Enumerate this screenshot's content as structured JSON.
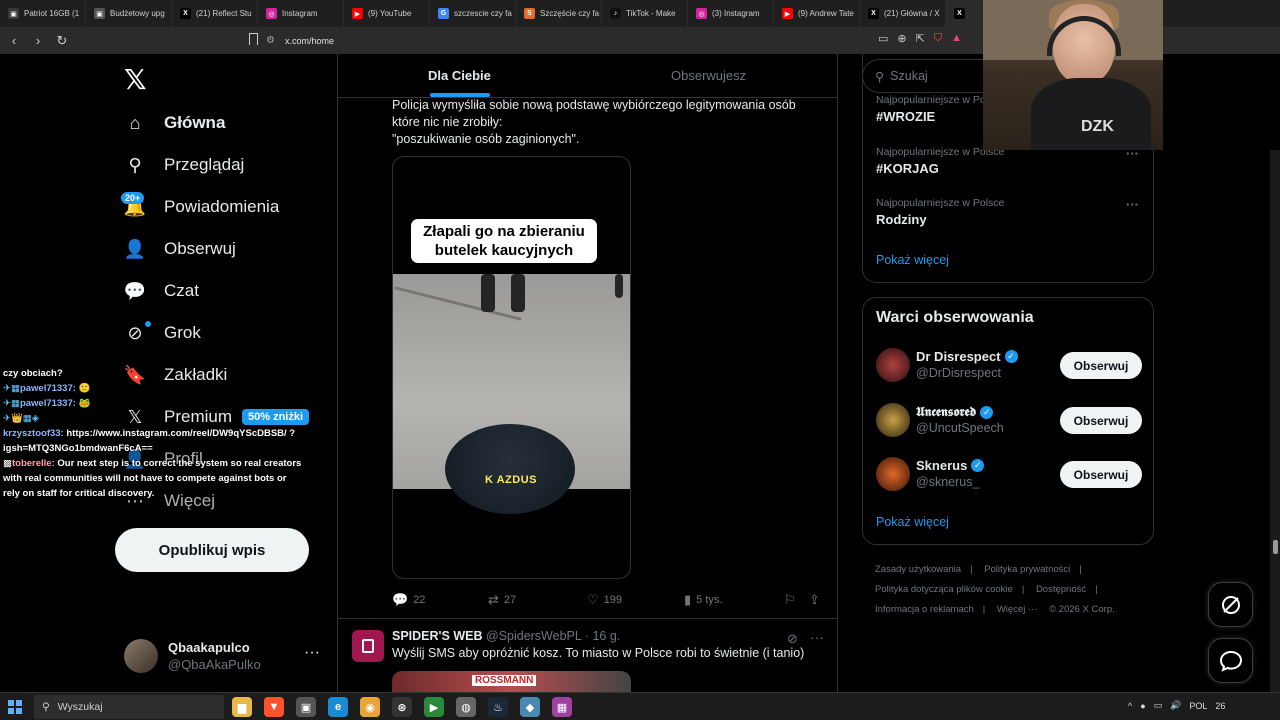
{
  "browser": {
    "tabs": [
      {
        "label": "Patriot 16GB (1",
        "color": "#3a3a3a",
        "glyph": "▣"
      },
      {
        "label": "Budżetowy upg",
        "color": "#555",
        "glyph": "▣"
      },
      {
        "label": "(21) Reflect Stu",
        "color": "#000",
        "glyph": "X"
      },
      {
        "label": "Instagram",
        "color": "#d6249f",
        "glyph": "◎"
      },
      {
        "label": "(9) YouTube",
        "color": "#ff0000",
        "glyph": "▶"
      },
      {
        "label": "szczescie czy fa",
        "color": "#4285f4",
        "glyph": "G"
      },
      {
        "label": "Szczęście czy fa",
        "color": "#e86a2a",
        "glyph": "S"
      },
      {
        "label": "TikTok - Make",
        "color": "#111",
        "glyph": "♪"
      },
      {
        "label": "(3) Instagram",
        "color": "#d6249f",
        "glyph": "◎"
      },
      {
        "label": "(9) Andrew Tate",
        "color": "#ff0000",
        "glyph": "▶"
      },
      {
        "label": "(21) Główna / X",
        "color": "#000",
        "glyph": "X"
      }
    ],
    "active_tab_glyph": "X",
    "url": "x.com/home"
  },
  "sidebar": {
    "logo": "𝕏",
    "items": [
      {
        "label": "Główna",
        "icon": "home-icon",
        "glyph": "⌂"
      },
      {
        "label": "Przeglądaj",
        "icon": "search-icon",
        "glyph": "⚲"
      },
      {
        "label": "Powiadomienia",
        "icon": "bell-icon",
        "glyph": "🔔"
      },
      {
        "label": "Obserwuj",
        "icon": "follow-icon",
        "glyph": "👤"
      },
      {
        "label": "Czat",
        "icon": "chat-icon",
        "glyph": "💬"
      },
      {
        "label": "Grok",
        "icon": "grok-icon",
        "glyph": "⊘"
      },
      {
        "label": "Zakładki",
        "icon": "bookmark-icon",
        "glyph": "🔖"
      },
      {
        "label": "Premium",
        "icon": "x-premium-icon",
        "glyph": "𝕏"
      },
      {
        "label": "Profil",
        "icon": "profile-icon",
        "glyph": "👤"
      },
      {
        "label": "Więcej",
        "icon": "more-icon",
        "glyph": "⋯"
      }
    ],
    "notif_badge": "20+",
    "premium_badge": "50% zniżki",
    "post_button": "Opublikuj wpis",
    "account": {
      "name": "Qbaakapulco",
      "handle": "@QbaAkaPulko",
      "more": "···"
    }
  },
  "chat_overlay": {
    "lines": [
      {
        "user": "",
        "msg": "czy obciach?"
      },
      {
        "user": "pawel71337:",
        "msg": ""
      },
      {
        "user": "pawel71337:",
        "msg": ""
      },
      {
        "user": "",
        "msg": ""
      },
      {
        "user": "krzysztoof33:",
        "msg": "https://www.instagram.com/reel/DW9qYScDBSB/ ?igsh=MTQ3NGo1bmdwanF6cA=="
      },
      {
        "user": "toberelle:",
        "msg": "Our next step is to correct the system so real creators with real communities will not have to compete against bots or rely on staff for critical discovery."
      }
    ]
  },
  "main": {
    "tabs": [
      "Dla Ciebie",
      "Obserwujesz"
    ],
    "tweet1": {
      "text_lines": [
        "Policja wymyśliła sobie nową podstawę wybiórczego legitymowania osób",
        "które nic nie zrobiły:",
        "\"poszukiwanie osób zaginionych\"."
      ],
      "video_caption": "Złapali go na zbieraniu butelek kaucyjnych",
      "video_subtitle": "K AZDUS",
      "replies": "22",
      "reposts": "27",
      "likes": "199",
      "views": "5 tys."
    },
    "tweet2": {
      "name": "SPIDER'S WEB",
      "handle": "@SpidersWebPL",
      "time": "· 16 g.",
      "text": "Wyślij SMS aby opróżnić kosz. To miasto w Polsce robi to świetnie (i tanio)",
      "thumb_label": "ROSSMANN"
    }
  },
  "right": {
    "search_placeholder": "Szukaj",
    "trends": [
      {
        "context": "Najpopularniejsze w Polsce",
        "tag": "#WROZIE"
      },
      {
        "context": "Najpopularniejsze w Polsce",
        "tag": "#KORJAG"
      },
      {
        "context": "Najpopularniejsze w Polsce",
        "tag": "Rodziny"
      }
    ],
    "trends_show_more": "Pokaż więcej",
    "follow_title": "Warci obserwowania",
    "follows": [
      {
        "name": "Dr Disrespect",
        "handle": "@DrDisrespect",
        "button": "Obserwuj",
        "color": "#6b1d1d"
      },
      {
        "name": "𝖀𝖓𝖈𝖊𝖓𝖘𝖔𝖗𝖊𝖉",
        "handle": "@UncutSpeech",
        "button": "Obserwuj",
        "color": "#4a3a1a"
      },
      {
        "name": "Sknerus",
        "handle": "@sknerus_",
        "button": "Obserwuj",
        "color": "#7a2a10"
      }
    ],
    "follow_show_more": "Pokaż więcej",
    "footer": [
      "Zasady użytkowania",
      "|",
      "Polityka prywatności",
      "|",
      "Polityka dotycząca plików cookie",
      "|",
      "Dostępność",
      "|",
      "Informacja o reklamach",
      "|",
      "Więcej ···",
      "© 2026 X Corp."
    ]
  },
  "taskbar": {
    "search": "Wyszukaj",
    "tray_lang": "POL",
    "tray_time": "26"
  }
}
